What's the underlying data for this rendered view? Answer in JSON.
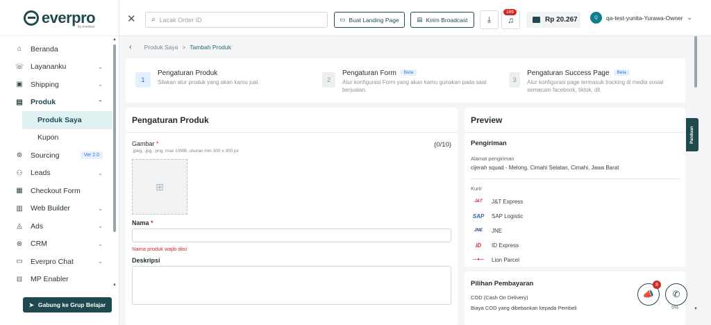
{
  "brand": {
    "name": "everpro",
    "sub": "by everbox"
  },
  "sidebar": {
    "items": [
      {
        "icon": "⌂",
        "label": "Beranda",
        "chev": ""
      },
      {
        "icon": "☏",
        "label": "Layananku",
        "chev": "⌄"
      },
      {
        "icon": "▣",
        "label": "Shipping",
        "chev": "⌄"
      },
      {
        "icon": "▤",
        "label": "Produk",
        "chev": "⌃"
      },
      {
        "icon": "",
        "label": "Produk Saya",
        "chev": ""
      },
      {
        "icon": "",
        "label": "Kupon",
        "chev": ""
      },
      {
        "icon": "⊚",
        "label": "Sourcing",
        "badge": "Ver 2.0"
      },
      {
        "icon": "⚇",
        "label": "Leads",
        "chev": "⌄"
      },
      {
        "icon": "▦",
        "label": "Checkout Form",
        "chev": ""
      },
      {
        "icon": "▥",
        "label": "Web Builder",
        "chev": "⌄"
      },
      {
        "icon": "◬",
        "label": "Ads",
        "chev": "⌄"
      },
      {
        "icon": "⊛",
        "label": "CRM",
        "chev": "⌄"
      },
      {
        "icon": "▭",
        "label": "Everpro Chat",
        "chev": "⌄"
      },
      {
        "icon": "⊟",
        "label": "MP Enabler",
        "chev": ""
      }
    ],
    "join_button": "Gabung ke Grup Belajar"
  },
  "topbar": {
    "search_placeholder": "Lacak Order ID",
    "landing_button": "Buat Landing Page",
    "broadcast_button": "Kirim Broadcast",
    "notif_count": "189",
    "balance": "Rp 20.267",
    "user_initial": "Q",
    "user_name": "qa-test-yunita-Yurawa-Owner"
  },
  "breadcrumb": {
    "parent": "Produk Saya",
    "sep": ">",
    "current": "Tambah Produk"
  },
  "steps": [
    {
      "num": "1",
      "title": "Pengaturan Produk",
      "desc": "Silakan atur produk yang akan kamu jual.",
      "beta": ""
    },
    {
      "num": "2",
      "title": "Pengaturan Form",
      "desc": "Atur konfigurasi Form yang akan kamu gunakan pada saat berjualan.",
      "beta": "Beta"
    },
    {
      "num": "3",
      "title": "Pengaturan Success Page",
      "desc": "Atur konfigurasi page termasuk tracking di media sosial semacam facebook, tiktok, dll.",
      "beta": "Beta"
    }
  ],
  "form": {
    "title": "Pengaturan Produk",
    "image_label": "Gambar",
    "image_hint": ".jpeg, .jpg, .png, max 10MB, ukuran min 300 x 300 px",
    "image_counter": "(0/10)",
    "name_label": "Nama",
    "name_error": "Nama produk wajib diisi",
    "desc_label": "Deskripsi"
  },
  "preview": {
    "title": "Preview",
    "shipping_heading": "Pengiriman",
    "address_label": "Alamat pengiriman",
    "address": "cijerah squad - Melong, Cimahi Selatan, Cimahi, Jawa Barat",
    "courier_label": "Kurir",
    "couriers": [
      "J&T Express",
      "SAP Logistic",
      "JNE",
      "ID Express",
      "Lion Parcel"
    ],
    "payment_heading": "Pilihan Pembayaran",
    "cod_title": "COD (Cash On Delivery)",
    "cod_desc": "Biaya COD yang dibebankan kepada Pembeli",
    "cod_pct": "5%"
  },
  "panduan": "Panduan",
  "fab_badge": "8"
}
